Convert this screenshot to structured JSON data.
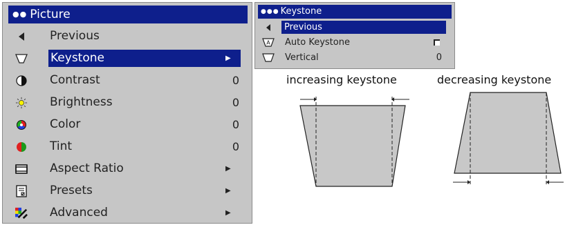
{
  "main_menu": {
    "title": "Picture",
    "items": [
      {
        "label": "Previous",
        "icon": "left-arrow-icon",
        "value": "",
        "submenu": false
      },
      {
        "label": "Keystone",
        "icon": "keystone-icon",
        "value": "",
        "submenu": true
      },
      {
        "label": "Contrast",
        "icon": "contrast-icon",
        "value": "0",
        "submenu": false
      },
      {
        "label": "Brightness",
        "icon": "brightness-icon",
        "value": "0",
        "submenu": false
      },
      {
        "label": "Color",
        "icon": "color-icon",
        "value": "0",
        "submenu": false
      },
      {
        "label": "Tint",
        "icon": "tint-icon",
        "value": "0",
        "submenu": false
      },
      {
        "label": "Aspect Ratio",
        "icon": "aspect-ratio-icon",
        "value": "",
        "submenu": true
      },
      {
        "label": "Presets",
        "icon": "presets-icon",
        "value": "",
        "submenu": true
      },
      {
        "label": "Advanced",
        "icon": "advanced-icon",
        "value": "",
        "submenu": true
      }
    ],
    "selected": "Keystone"
  },
  "sub_menu": {
    "title": "Keystone",
    "items": [
      {
        "label": "Previous",
        "icon": "left-arrow-icon",
        "value": ""
      },
      {
        "label": "Auto Keystone",
        "icon": "auto-keystone-icon",
        "value": ""
      },
      {
        "label": "Vertical",
        "icon": "keystone-icon",
        "value": "0"
      }
    ],
    "auto_keystone_checked": false,
    "selected": "Previous"
  },
  "diagrams": {
    "increasing": "increasing keystone",
    "decreasing": "decreasing keystone"
  },
  "colors": {
    "highlight": "#0e1f8c",
    "menu_bg": "#c6c6c6",
    "shape_fill": "#c8c8c8"
  }
}
